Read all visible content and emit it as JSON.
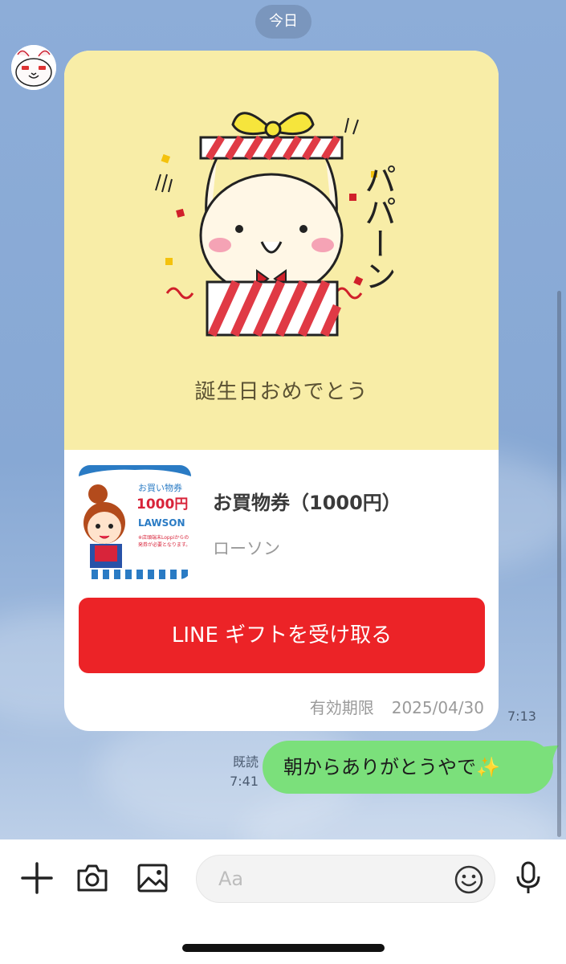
{
  "date_divider": "今日",
  "gift_card": {
    "message": "誕生日おめでとう",
    "product_title": "お買物券（1000円）",
    "shop": "ローソン",
    "receive_label": "LINE ギフトを受け取る",
    "expiry_label": "有効期限",
    "expiry_date": "2025/04/30",
    "sticker_text": "パパーン",
    "voucher_image": {
      "heading": "お買い物券",
      "amount": "1000円",
      "brand": "LAWSON",
      "note_line1": "※店頭端末Loppiからの",
      "note_line2": "発券が必要となります。"
    }
  },
  "received_time": "7:13",
  "sent_message": {
    "text": "朝からありがとうやで✨",
    "read_label": "既読",
    "time": "7:41"
  },
  "composer": {
    "placeholder": "Aa",
    "icons": [
      "plus-icon",
      "camera-icon",
      "image-icon",
      "emoji-icon",
      "microphone-icon"
    ]
  },
  "colors": {
    "chat_bg": "#8aabd6",
    "card_top": "#f8eda7",
    "receive_button": "#ec2327",
    "sent_bubble": "#7be07b"
  }
}
